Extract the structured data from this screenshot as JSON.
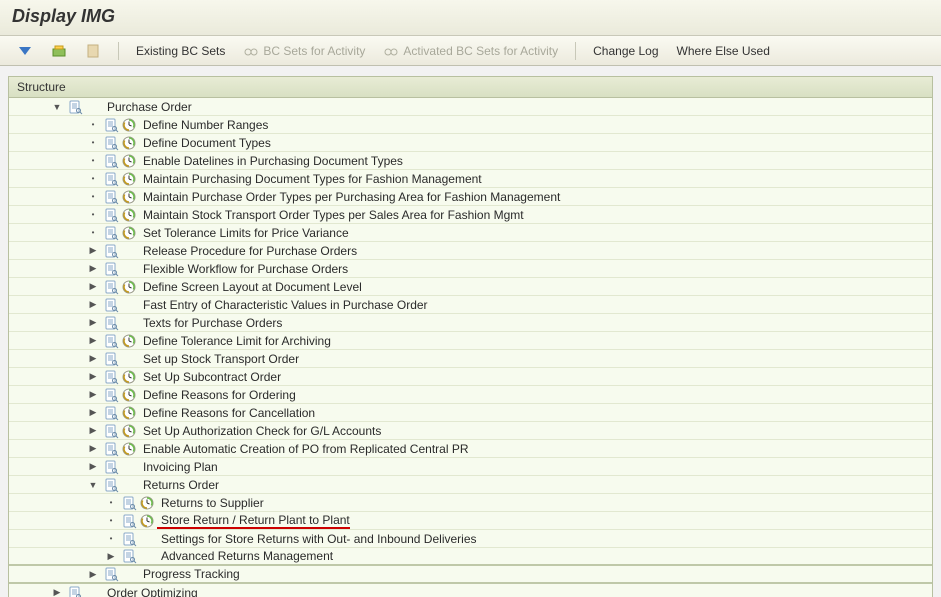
{
  "title": "Display IMG",
  "toolbar": {
    "existing_bc_sets": "Existing BC Sets",
    "bc_sets_for_activity": "BC Sets for Activity",
    "activated_bc_sets": "Activated BC Sets for Activity",
    "change_log": "Change Log",
    "where_else_used": "Where Else Used"
  },
  "section_label": "Structure",
  "tree": {
    "root": "Purchase Order",
    "items": [
      {
        "label": "Define Number Ranges",
        "exec": true,
        "leaf": true
      },
      {
        "label": "Define Document Types",
        "exec": true,
        "leaf": true
      },
      {
        "label": "Enable Datelines in Purchasing Document Types",
        "exec": true,
        "leaf": true
      },
      {
        "label": "Maintain Purchasing Document Types for Fashion Management",
        "exec": true,
        "leaf": true
      },
      {
        "label": "Maintain Purchase Order Types per Purchasing Area for Fashion Management",
        "exec": true,
        "leaf": true
      },
      {
        "label": "Maintain Stock Transport Order Types per Sales Area for Fashion Mgmt",
        "exec": true,
        "leaf": true
      },
      {
        "label": "Set Tolerance Limits for Price Variance",
        "exec": true,
        "leaf": true
      },
      {
        "label": "Release Procedure for Purchase Orders",
        "exec": false,
        "leaf": false
      },
      {
        "label": "Flexible Workflow for Purchase Orders",
        "exec": false,
        "leaf": false
      },
      {
        "label": "Define Screen Layout at Document Level",
        "exec": true,
        "leaf": false
      },
      {
        "label": "Fast Entry of Characteristic Values in Purchase Order",
        "exec": false,
        "leaf": false
      },
      {
        "label": "Texts for Purchase Orders",
        "exec": false,
        "leaf": false
      },
      {
        "label": "Define Tolerance Limit for Archiving",
        "exec": true,
        "leaf": false
      },
      {
        "label": "Set up Stock Transport Order",
        "exec": false,
        "leaf": false
      },
      {
        "label": "Set Up Subcontract Order",
        "exec": true,
        "leaf": false
      },
      {
        "label": "Define Reasons for Ordering",
        "exec": true,
        "leaf": false
      },
      {
        "label": "Define Reasons for Cancellation",
        "exec": true,
        "leaf": false
      },
      {
        "label": "Set Up Authorization Check for G/L Accounts",
        "exec": true,
        "leaf": false
      },
      {
        "label": "Enable Automatic Creation of PO from Replicated Central PR",
        "exec": true,
        "leaf": false
      },
      {
        "label": "Invoicing Plan",
        "exec": false,
        "leaf": false
      }
    ],
    "returns_order": "Returns Order",
    "returns_children": [
      {
        "label": "Returns to Supplier",
        "exec": true,
        "leaf": true
      },
      {
        "label": "Store Return / Return Plant to Plant",
        "exec": true,
        "leaf": true,
        "highlight": true
      },
      {
        "label": "Settings for Store Returns with Out- and Inbound Deliveries",
        "exec": false,
        "leaf": true
      },
      {
        "label": "Advanced Returns Management",
        "exec": false,
        "leaf": false
      }
    ],
    "progress_tracking": "Progress Tracking",
    "order_optimizing": "Order Optimizing"
  }
}
